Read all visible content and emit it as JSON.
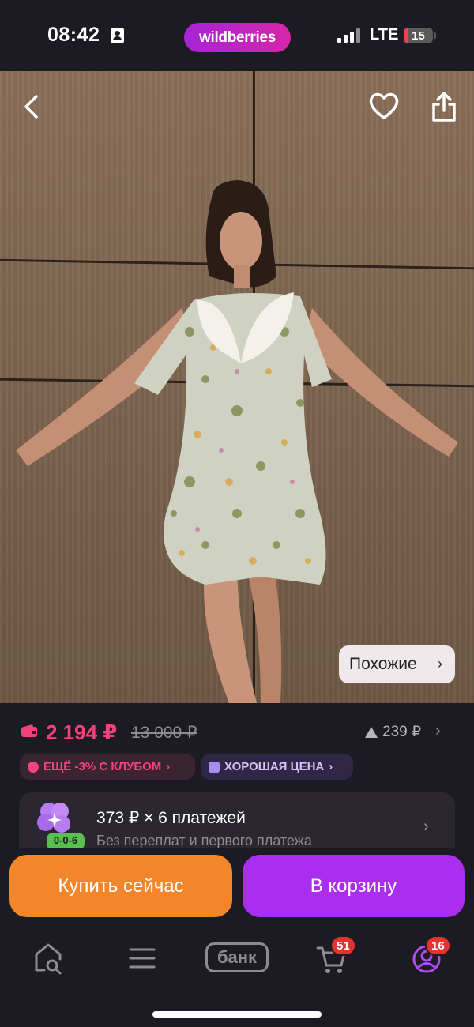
{
  "status_bar": {
    "time": "08:42",
    "brand": "wildberries",
    "network": "LTE",
    "battery": "15",
    "battery_level": 0.15
  },
  "product": {
    "actions": {
      "back": "back-icon",
      "favorite": "heart-icon",
      "share": "share-icon"
    },
    "similar_label": "Похожие",
    "price": "2 194 ₽",
    "old_price": "13 000 ₽",
    "price_up": "239 ₽",
    "badges": {
      "club": "ЕЩЁ -3% С КЛУБОМ",
      "good_price": "ХОРОШАЯ ЦЕНА"
    },
    "installment": {
      "main": "373 ₽ × 6 платежей",
      "sub": "Без переплат и первого платежа",
      "tag": "0-0-6"
    }
  },
  "buttons": {
    "buy_now": "Купить сейчас",
    "add_to_cart": "В корзину"
  },
  "tabbar": {
    "bank_label": "банк",
    "cart_count": "51",
    "profile_count": "16"
  },
  "colors": {
    "price": "#f1437a",
    "buy": "#f3862a",
    "cart": "#a92ef0",
    "brand_gradient": [
      "#a724d8",
      "#d626a8"
    ]
  }
}
